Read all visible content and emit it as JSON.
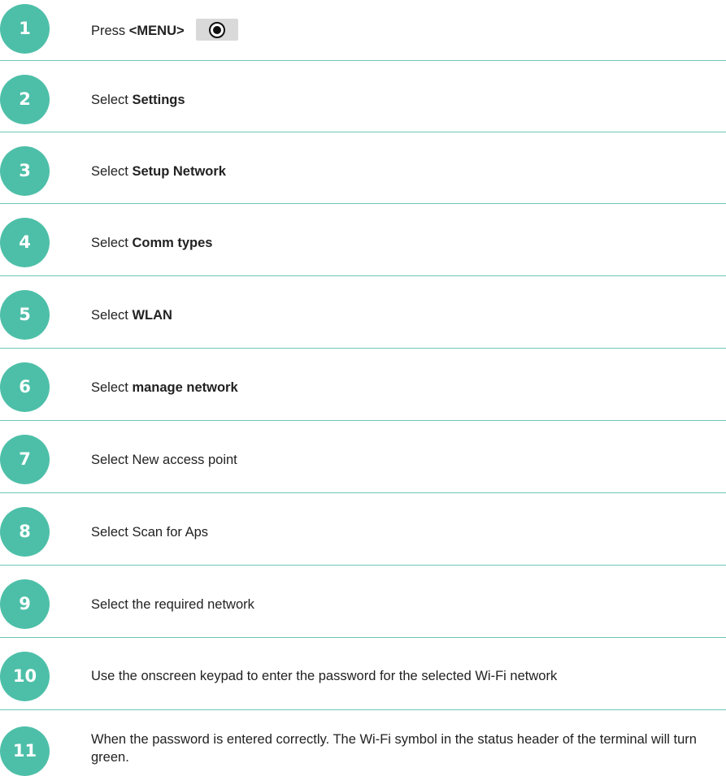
{
  "steps": [
    {
      "number": "1",
      "prefix": "Press ",
      "bold": "<MENU>",
      "suffix": "",
      "icon": "menu-button-icon"
    },
    {
      "number": "2",
      "prefix": "Select ",
      "bold": "Settings",
      "suffix": ""
    },
    {
      "number": "3",
      "prefix": "Select ",
      "bold": "Setup Network",
      "suffix": ""
    },
    {
      "number": "4",
      "prefix": "Select ",
      "bold": "Comm types",
      "suffix": ""
    },
    {
      "number": "5",
      "prefix": "Select ",
      "bold": "WLAN",
      "suffix": ""
    },
    {
      "number": "6",
      "prefix": "Select ",
      "bold": "manage network",
      "suffix": ""
    },
    {
      "number": "7",
      "prefix": "Select New access point",
      "bold": "",
      "suffix": ""
    },
    {
      "number": "8",
      "prefix": "Select Scan for Aps",
      "bold": "",
      "suffix": ""
    },
    {
      "number": "9",
      "prefix": "Select the required network",
      "bold": "",
      "suffix": ""
    },
    {
      "number": "10",
      "prefix": "Use the onscreen keypad to enter the password for the selected Wi-Fi network",
      "bold": "",
      "suffix": ""
    },
    {
      "number": "11",
      "prefix": "When the password is entered correctly. The Wi-Fi symbol in the status header of the terminal will turn green.",
      "bold": "",
      "suffix": ""
    }
  ],
  "colors": {
    "badge": "#4dbfa8",
    "divider": "#6cc6b6",
    "text": "#222222"
  }
}
